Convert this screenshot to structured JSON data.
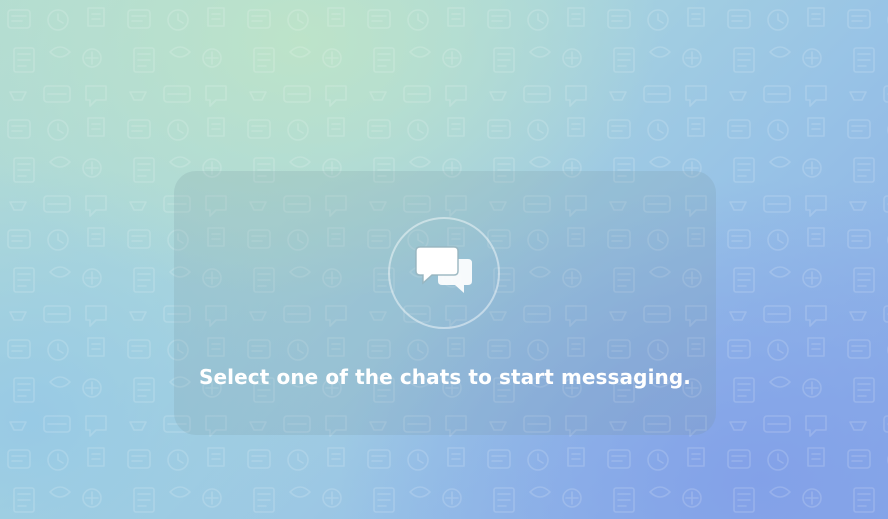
{
  "empty_state": {
    "icon": "chat-bubbles-icon",
    "message": "Select one of the chats to start messaging."
  },
  "background": {
    "pattern_icon": "doodle-pattern",
    "accent_colors": [
      "#b3dcd2",
      "#98c3e6",
      "#88a9e8"
    ]
  }
}
